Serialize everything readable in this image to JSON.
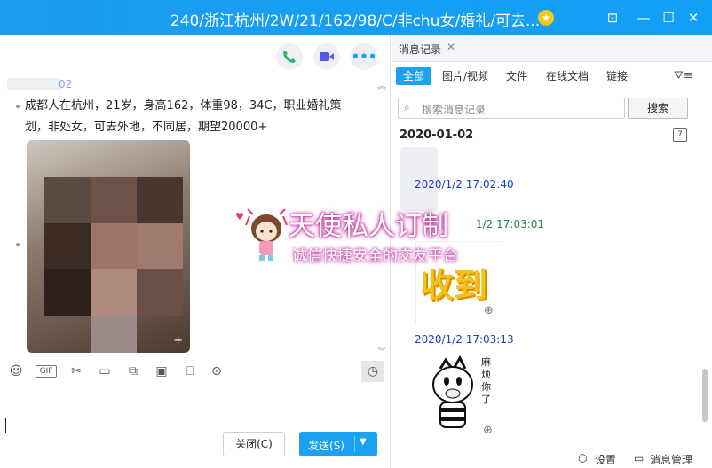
{
  "window": {
    "title": "240/浙江杭州/2W/21/162/98/C/非chu女/婚礼/可去...",
    "minimize": "—",
    "maximize": "☐",
    "close": "✕",
    "extra": "⊡"
  },
  "chat": {
    "sender_tail": "02",
    "message_text": "成都人在杭州，21岁，身高162，体重98，34C，职业婚礼策划，非处女，可去外地，不同居，期望20000+",
    "photo_label": "+"
  },
  "composer": {
    "close_label": "关闭(C)",
    "send_label": "发送(S)",
    "gif_label": "GIF"
  },
  "history": {
    "tab_label": "消息记录",
    "filters": [
      "全部",
      "图片/视频",
      "文件",
      "在线文档",
      "链接"
    ],
    "search_placeholder": "搜索消息记录",
    "search_button": "搜索",
    "date": "2020-01-02",
    "cal_day": "7",
    "entries": [
      {
        "time": "2020/1/2 17:02:40"
      },
      {
        "time": "1/2 17:03:01"
      },
      {
        "time": "2020/1/2 17:03:13"
      }
    ],
    "sticker1_text": "收到",
    "sticker2_text": "麻烦你了",
    "footer": {
      "settings": "设置",
      "manage": "消息管理"
    }
  },
  "watermark": {
    "title": "天使私人订制",
    "subtitle": "诚信快捷安全的交友平台"
  },
  "colors": {
    "accent": "#1aa1f0",
    "title_bar": "#1a9cf0"
  }
}
